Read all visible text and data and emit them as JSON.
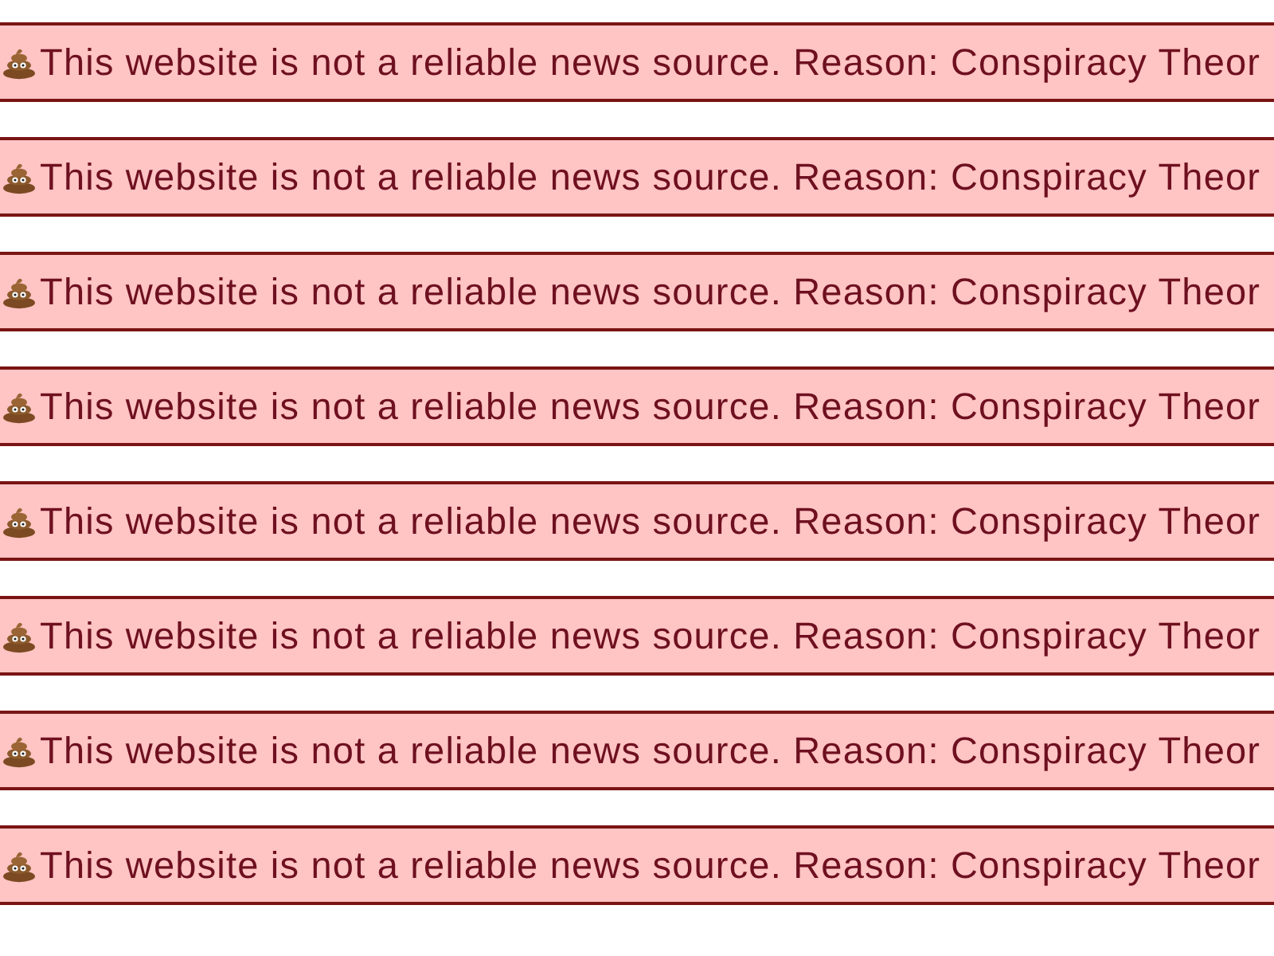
{
  "banners": [
    {
      "text": "This website is not a reliable news source. Reason: Conspiracy Theor"
    },
    {
      "text": "This website is not a reliable news source. Reason: Conspiracy Theor"
    },
    {
      "text": "This website is not a reliable news source. Reason: Conspiracy Theor"
    },
    {
      "text": "This website is not a reliable news source. Reason: Conspiracy Theor"
    },
    {
      "text": "This website is not a reliable news source. Reason: Conspiracy Theor"
    },
    {
      "text": "This website is not a reliable news source. Reason: Conspiracy Theor"
    },
    {
      "text": "This website is not a reliable news source. Reason: Conspiracy Theor"
    },
    {
      "text": "This website is not a reliable news source. Reason: Conspiracy Theor"
    }
  ]
}
